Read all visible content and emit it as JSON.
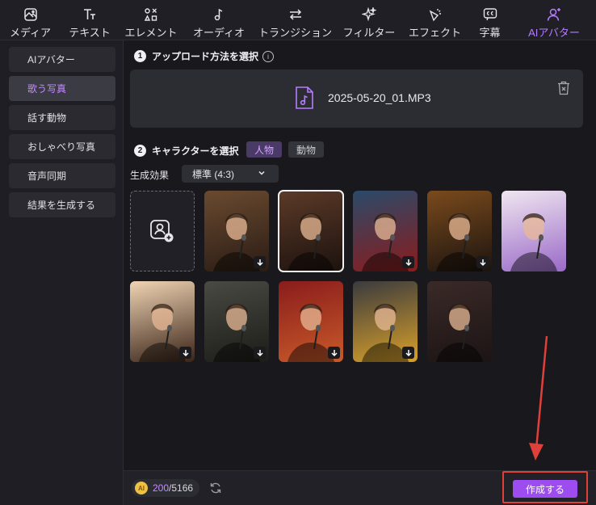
{
  "toolbar": {
    "items": [
      {
        "label": "メディア",
        "icon": "media-icon"
      },
      {
        "label": "テキスト",
        "icon": "text-icon"
      },
      {
        "label": "エレメント",
        "icon": "element-icon"
      },
      {
        "label": "オーディオ",
        "icon": "audio-icon"
      },
      {
        "label": "トランジション",
        "icon": "transition-icon"
      },
      {
        "label": "フィルター",
        "icon": "filter-icon"
      },
      {
        "label": "エフェクト",
        "icon": "effect-icon"
      },
      {
        "label": "字幕",
        "icon": "subtitle-icon"
      },
      {
        "label": "AIアバター",
        "icon": "ai-avatar-icon",
        "active": true
      }
    ]
  },
  "sidebar": {
    "items": [
      {
        "label": "AIアバター"
      },
      {
        "label": "歌う写真",
        "active": true
      },
      {
        "label": "話す動物"
      },
      {
        "label": "おしゃべり写真"
      },
      {
        "label": "音声同期"
      },
      {
        "label": "結果を生成する"
      }
    ]
  },
  "upload": {
    "step_number": "1",
    "title": "アップロード方法を選択",
    "info": "i",
    "file_name": "2025-05-20_01.MP3"
  },
  "character": {
    "step_number": "2",
    "title": "キャラクターを選択",
    "tabs": [
      {
        "label": "人物",
        "active": true
      },
      {
        "label": "動物",
        "active": false
      }
    ],
    "effect_label": "生成効果",
    "effect_value": "標準 (4:3)",
    "tiles": [
      {
        "id": "boy-hat-singer",
        "bg": [
          "#6a4a30",
          "#2a1c14"
        ],
        "download": true
      },
      {
        "id": "woman-bar-singer",
        "bg": [
          "#5c3a28",
          "#1c120e"
        ],
        "download": false,
        "selected": true
      },
      {
        "id": "boy-red-jacket",
        "bg": [
          "#2a4a6a",
          "#8a1c1c"
        ],
        "download": true
      },
      {
        "id": "woman-bokeh-singer",
        "bg": [
          "#7a4a1c",
          "#1c1410"
        ],
        "download": true
      },
      {
        "id": "anime-girl-singer",
        "bg": [
          "#f0e6f0",
          "#9a6ac8"
        ],
        "download": false
      },
      {
        "id": "illustrated-woman",
        "bg": [
          "#f0d4b4",
          "#3a2418"
        ],
        "download": true
      },
      {
        "id": "bearded-man-cap",
        "bg": [
          "#4a4a44",
          "#1c1c18"
        ],
        "download": true
      },
      {
        "id": "curly-boy-red",
        "bg": [
          "#8a1c1c",
          "#c85a2a"
        ],
        "download": true
      },
      {
        "id": "blond-boy-yellow",
        "bg": [
          "#3a3a3e",
          "#d8a02a"
        ],
        "download": true
      },
      {
        "id": "teen-suit",
        "bg": [
          "#3a2a28",
          "#1c1414"
        ],
        "download": false
      }
    ]
  },
  "footer": {
    "credits_used": "200",
    "credits_total": "/5166",
    "coin_label": "AI",
    "create_label": "作成する"
  },
  "colors": {
    "accent": "#b57cff",
    "create_button": "#9d4cf0",
    "highlight_frame": "#e0403a"
  }
}
